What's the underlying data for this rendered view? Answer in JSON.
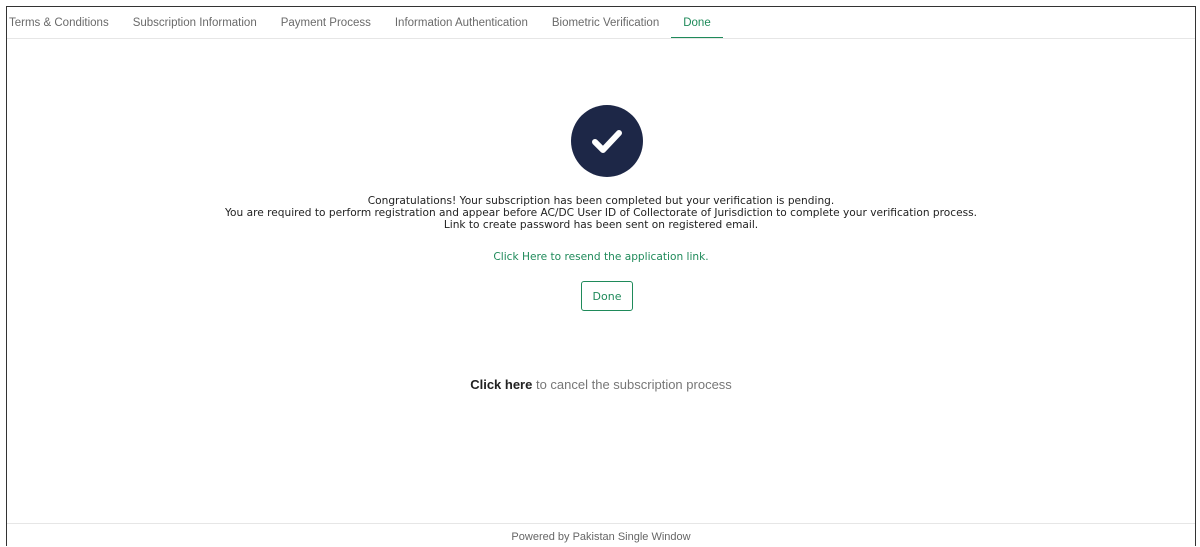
{
  "tabs": [
    {
      "label": "Terms & Conditions"
    },
    {
      "label": "Subscription Information"
    },
    {
      "label": "Payment Process"
    },
    {
      "label": "Information Authentication"
    },
    {
      "label": "Biometric Verification"
    },
    {
      "label": "Done"
    }
  ],
  "status": {
    "line1": "Congratulations! Your subscription has been completed but your verification is pending.",
    "line2": "You are required to perform registration and appear before AC/DC User ID of Collectorate of Jurisdiction to complete your verification process.",
    "line3": "Link to create password has been sent on registered email."
  },
  "resend_link": "Click Here to resend the application link.",
  "done_button": "Done",
  "cancel": {
    "link": "Click here",
    "text": " to cancel the subscription process"
  },
  "footer": "Powered by Pakistan Single Window",
  "colors": {
    "accent": "#1f8a5a",
    "check_circle": "#1d2747"
  },
  "icons": {
    "success": "check-circle-icon"
  }
}
